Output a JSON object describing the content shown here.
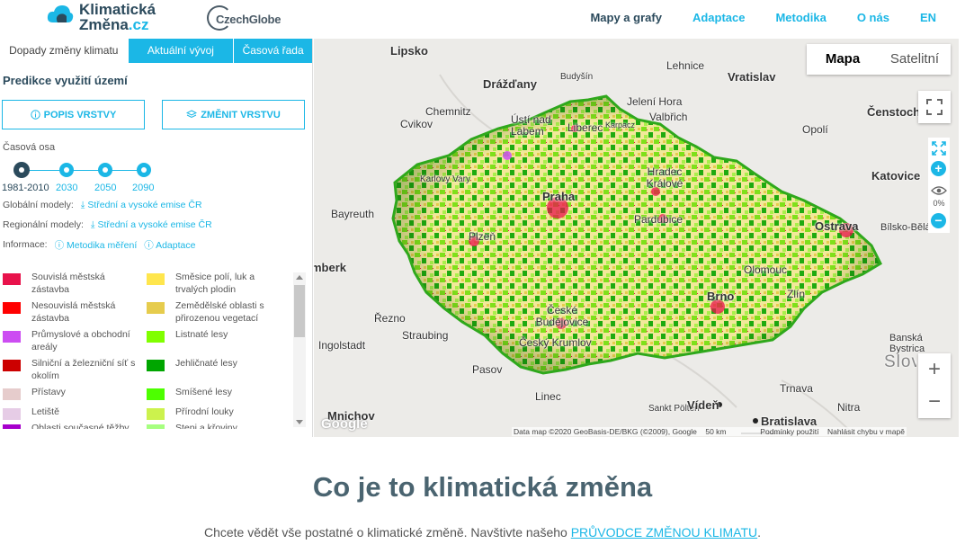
{
  "header": {
    "logo_line1": "Klimatická",
    "logo_line2": "Změna",
    "logo_tld": ".cz",
    "partner": "CzechGlobe",
    "nav": [
      "Mapy a grafy",
      "Adaptace",
      "Metodika",
      "O nás",
      "EN"
    ],
    "nav_active": "Mapy a grafy"
  },
  "panel": {
    "tabs": [
      "Dopady změny klimatu",
      "Aktuální vývoj",
      "Časová řada"
    ],
    "title": "Predikce využití území",
    "btn_describe": "POPIS VRSTVY",
    "btn_change": "ZMĚNIT VRSTVU",
    "timeline_label": "Časová osa",
    "timeline": [
      "1981-2010",
      "2030",
      "2050",
      "2090"
    ],
    "timeline_selected": "1981-2010",
    "global_label": "Globální modely:",
    "global_link": "Střední a vysoké emise ČR",
    "regional_label": "Regionální modely:",
    "regional_link": "Střední a vysoké emise ČR",
    "info_label": "Informace:",
    "info_link1": "Metodika měření",
    "info_link2": "Adaptace",
    "legend_left": [
      {
        "label": "Souvislá městská zástavba",
        "color": "#e8124b"
      },
      {
        "label": "Nesouvislá městská zástavba",
        "color": "#ff0000"
      },
      {
        "label": "Průmyslové a obchodní areály",
        "color": "#cc4df2"
      },
      {
        "label": "Silniční a železniční síť s okolím",
        "color": "#cc0000"
      },
      {
        "label": "Přístavy",
        "color": "#e6cccc"
      },
      {
        "label": "Letiště",
        "color": "#e6cce6"
      },
      {
        "label": "Oblasti současné těžby",
        "color": "#a600cc"
      }
    ],
    "legend_right": [
      {
        "label": "Směsice polí, luk a trvalých plodin",
        "color": "#ffe64d"
      },
      {
        "label": "Zemědělské oblasti s přirozenou vegetací",
        "color": "#e6cc4d"
      },
      {
        "label": "Listnaté lesy",
        "color": "#80ff00"
      },
      {
        "label": "Jehličnaté lesy",
        "color": "#00a600"
      },
      {
        "label": "Smíšené lesy",
        "color": "#4dff00"
      },
      {
        "label": "Přírodní louky",
        "color": "#ccf24d"
      },
      {
        "label": "Stepi a křoviny",
        "color": "#a6ff80"
      }
    ]
  },
  "map": {
    "maptype": [
      "Mapa",
      "Satelitní"
    ],
    "maptype_active": "Mapa",
    "opacity": "0%",
    "cities": [
      {
        "name": "Lipsko",
        "big": true
      },
      {
        "name": "Drážďany",
        "big": true
      },
      {
        "name": "Chemnitz",
        "big": false
      },
      {
        "name": "Budyšín",
        "big": false
      },
      {
        "name": "Lehnice",
        "big": false
      },
      {
        "name": "Vratislav",
        "big": true
      },
      {
        "name": "Jelení Hora",
        "big": false
      },
      {
        "name": "Valbřich",
        "big": false
      },
      {
        "name": "Ústí nad Labem",
        "big": false
      },
      {
        "name": "Liberec",
        "big": false
      },
      {
        "name": "Karpacz",
        "big": false
      },
      {
        "name": "Cvikov",
        "big": false
      },
      {
        "name": "Karlovy Vary",
        "big": false
      },
      {
        "name": "Praha",
        "big": true
      },
      {
        "name": "Hradec Králové",
        "big": false
      },
      {
        "name": "Pardubice",
        "big": false
      },
      {
        "name": "Opolí",
        "big": false
      },
      {
        "name": "Katovice",
        "big": true
      },
      {
        "name": "Čenstochová",
        "big": true
      },
      {
        "name": "Bayreuth",
        "big": false
      },
      {
        "name": "Plzeň",
        "big": false
      },
      {
        "name": "Ostrava",
        "big": true
      },
      {
        "name": "Bílsko-Bělá",
        "big": false
      },
      {
        "name": "Olomouc",
        "big": false
      },
      {
        "name": "Brno",
        "big": true
      },
      {
        "name": "Zlín",
        "big": false
      },
      {
        "name": "Norimberk",
        "big": true
      },
      {
        "name": "Řezno",
        "big": false
      },
      {
        "name": "Ingolstadt",
        "big": false
      },
      {
        "name": "Straubing",
        "big": false
      },
      {
        "name": "České Budějovice",
        "big": false
      },
      {
        "name": "Český Krumlov",
        "big": false
      },
      {
        "name": "Pasov",
        "big": false
      },
      {
        "name": "Linec",
        "big": false
      },
      {
        "name": "Mnichov",
        "big": true
      },
      {
        "name": "Sankt Pölten",
        "big": false
      },
      {
        "name": "Vídeň",
        "big": true
      },
      {
        "name": "Bratislava",
        "big": true
      },
      {
        "name": "Trnava",
        "big": false
      },
      {
        "name": "Nitra",
        "big": false
      },
      {
        "name": "Banská Bystrica",
        "big": false
      },
      {
        "name": "Slovensko",
        "big": false
      }
    ],
    "attribution": "Data map ©2020 GeoBasis-DE/BKG (©2009), Google",
    "scale": "50 km",
    "terms": "Podmínky použití",
    "report": "Nahlásit chybu v mapě",
    "google": "Google"
  },
  "bottom": {
    "headline": "Co je to klimatická změna",
    "text": "Chcete vědět vše postatné o klimatické změně. Navštivte našeho ",
    "link": "PRŮVODCE ZMĚNOU KLIMATU",
    "end": "."
  }
}
